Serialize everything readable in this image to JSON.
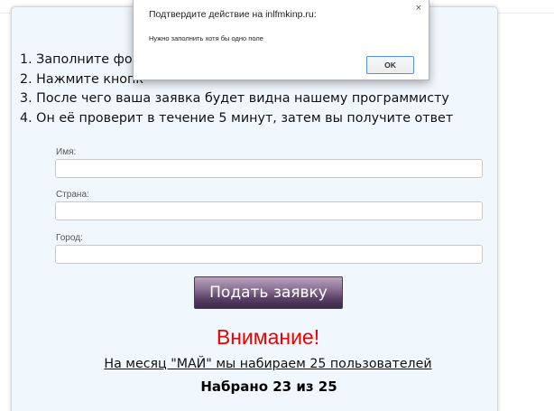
{
  "instructions": [
    "1. Заполните форм",
    "2. Нажмите кнопк",
    "3. После чего ваша заявка будет видна нашему программисту",
    "4. Он её проверит в течение 5 минут, затем вы получите ответ"
  ],
  "form": {
    "name_label": "Имя:",
    "name_value": "",
    "country_label": "Страна:",
    "country_value": "",
    "city_label": "Город:",
    "city_value": "",
    "submit_label": "Подать заявку"
  },
  "notice": {
    "title": "Внимание!",
    "month_text": "На месяц \"МАЙ\" мы набираем 25 пользователей",
    "count_text": "Набрано 23 из 25"
  },
  "dialog": {
    "title": "Подтвердите действие на inlfmkinp.ru:",
    "message": "Нужно заполнить хотя бы одно поле",
    "ok_label": "OK",
    "close_icon_glyph": "×"
  },
  "colors": {
    "card_background": "#f1f8fd",
    "attention_red": "#ee0000",
    "button_purple": "#5a3f66",
    "dialog_focus_blue": "#4d90fe"
  }
}
